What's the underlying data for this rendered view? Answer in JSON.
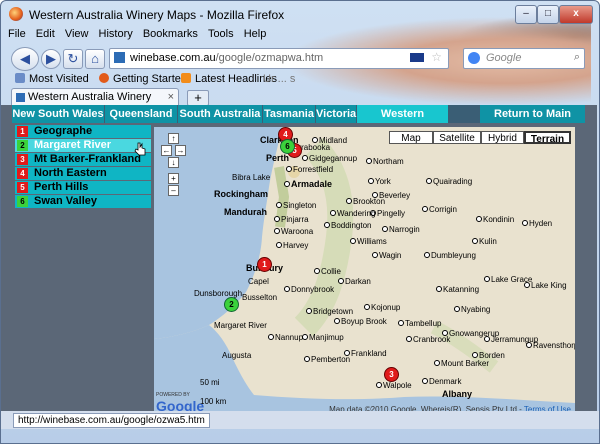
{
  "window": {
    "title": "Western Australia Winery Maps - Mozilla Firefox",
    "minimize": "–",
    "maximize": "□",
    "close": "x"
  },
  "menu": [
    "File",
    "Edit",
    "View",
    "History",
    "Bookmarks",
    "Tools",
    "Help"
  ],
  "nav": {
    "url_host": "winebase.com.au",
    "url_path": "/google/ozmapwa.htm",
    "search_placeholder": "Google"
  },
  "bookmarks": [
    "Most Visited",
    "Getting Started",
    "Latest Headlines",
    "Ur ... s"
  ],
  "tab": {
    "label": "Western Australia Winery Maps",
    "new_tab": "+"
  },
  "states": [
    "New South Wales",
    "Queensland",
    "South Australia",
    "Tasmania",
    "Victoria",
    "Western Australia"
  ],
  "active_state": "Western Australia",
  "return_label": "Return to Main Menu",
  "regions": [
    {
      "num": "1",
      "label": "Geographe",
      "color": "#e01b1b"
    },
    {
      "num": "2",
      "label": "Margaret River",
      "color": "#3bd23b"
    },
    {
      "num": "3",
      "label": "Mt Barker-Frankland",
      "color": "#e01b1b"
    },
    {
      "num": "4",
      "label": "North Eastern",
      "color": "#e01b1b"
    },
    {
      "num": "5",
      "label": "Perth Hills",
      "color": "#e01b1b"
    },
    {
      "num": "6",
      "label": "Swan Valley",
      "color": "#3bd23b"
    }
  ],
  "map": {
    "types": [
      "Map",
      "Satellite",
      "Hybrid",
      "Terrain"
    ],
    "active_type": "Terrain",
    "controls": [
      "↑",
      "←",
      "→",
      "↓",
      "+",
      "–"
    ],
    "towns": [
      "Clarkson",
      "Midland",
      "Perth",
      "Forrestfield",
      "Gidgegannup",
      "Bibra Lake",
      "Armadale",
      "Rockingham",
      "Singleton",
      "Pinjarra",
      "Mandurah",
      "Bunbury",
      "Capel",
      "Donnybrook",
      "Collie",
      "Dunsborough",
      "Busselton",
      "Margaret River",
      "Bridgetown",
      "Augusta",
      "Kojonup",
      "Manjimup",
      "Walpole",
      "Denmark",
      "Albany",
      "Mount Barker",
      "Katanning",
      "Wagin",
      "Narrogin",
      "Williams",
      "Northam",
      "York",
      "Beverley",
      "Quairading",
      "Kondinin",
      "Lake Grace",
      "Ravensthorpe",
      "Jerramungup",
      "Borden",
      "Cranbrook",
      "Mirrabooka",
      "Corrigin",
      "Pingelly",
      "Brookton",
      "Boyup Brook",
      "Darkan",
      "Lake King",
      "Hyden",
      "Nyabing",
      "Gnowangerup",
      "Tambellup",
      "Frankland",
      "Nannup",
      "Harvey",
      "Waroona",
      "Boddington",
      "Wandering",
      "Dumbleyung",
      "Kulin",
      "Pemberton"
    ],
    "markers": [
      {
        "num": "1",
        "color": "red"
      },
      {
        "num": "2",
        "color": "green"
      },
      {
        "num": "3",
        "color": "red"
      },
      {
        "num": "4",
        "color": "red"
      },
      {
        "num": "5",
        "color": "red"
      },
      {
        "num": "6",
        "color": "green"
      }
    ],
    "copyright": "Map data ©2010 Google, Whereis(R), Sensis Pty Ltd - ",
    "terms": "Terms of Use",
    "scale_mi": "50 mi",
    "scale_km": "100 km",
    "powered_by": "POWERED BY",
    "google_logo": "Google"
  },
  "status_text": "http://winebase.com.au/google/ozwa5.htm"
}
